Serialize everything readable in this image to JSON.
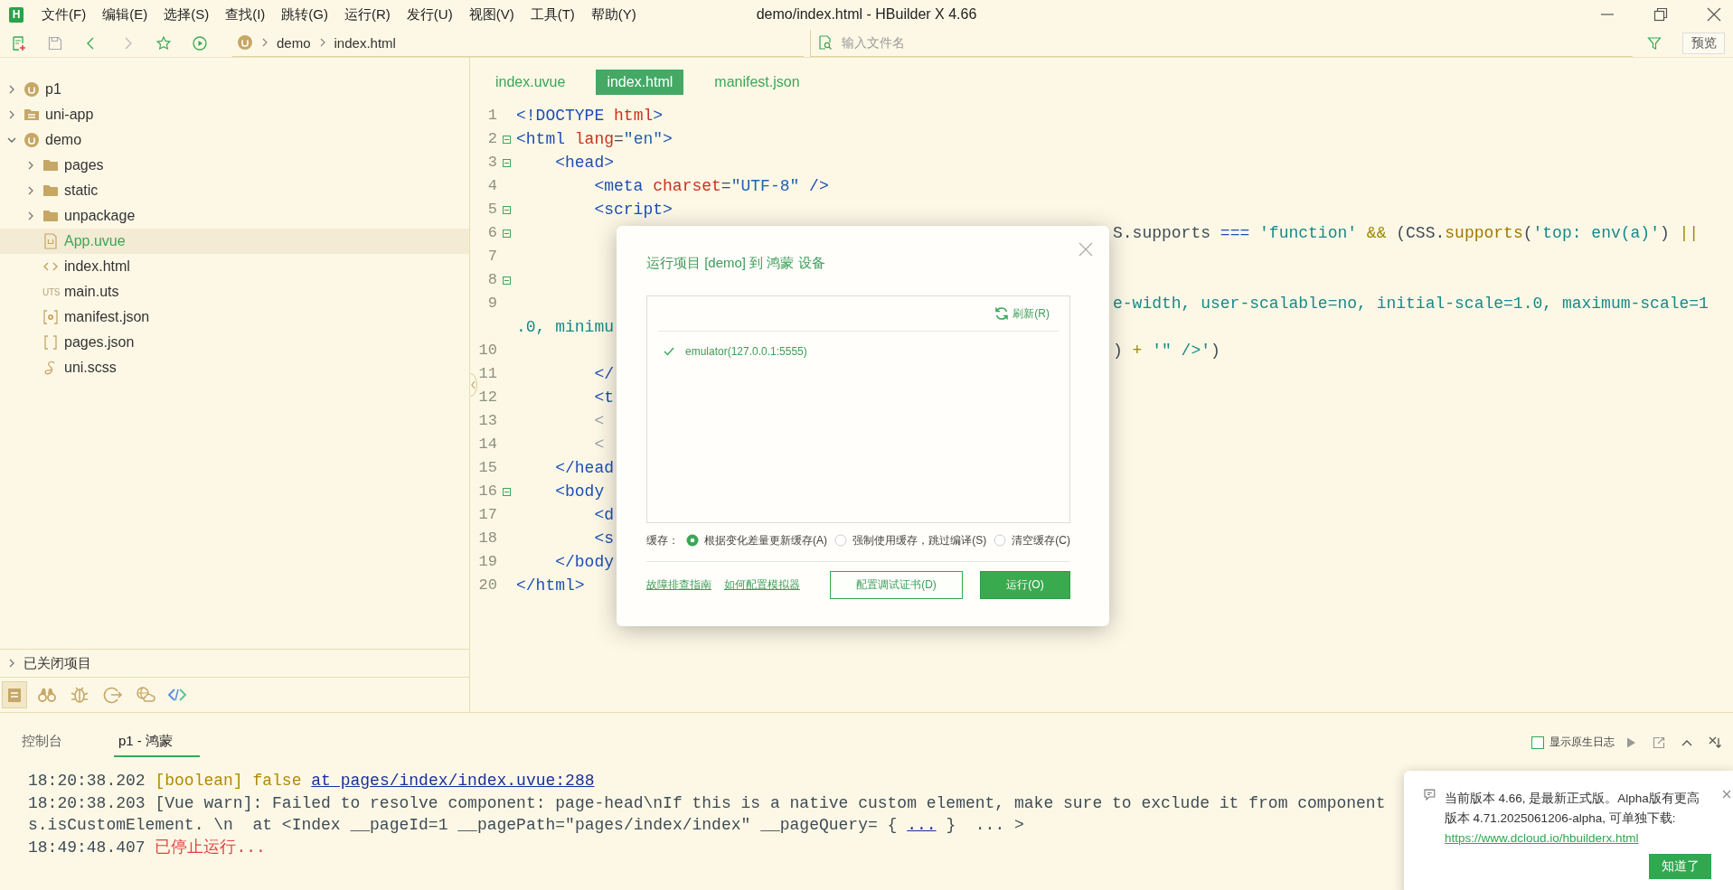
{
  "window": {
    "logo": "H",
    "title": "demo/index.html - HBuilder X 4.66"
  },
  "menu": [
    "文件(F)",
    "编辑(E)",
    "选择(S)",
    "查找(I)",
    "跳转(G)",
    "运行(R)",
    "发行(U)",
    "视图(V)",
    "工具(T)",
    "帮助(Y)"
  ],
  "toolbar": {
    "breadcrumb": [
      "demo",
      "index.html"
    ],
    "search": {
      "placeholder": "输入文件名"
    },
    "preview_button": "预览"
  },
  "sidebar": {
    "tree": [
      {
        "label": "p1",
        "kind": "project",
        "expanded": false,
        "selected": false
      },
      {
        "label": "uni-app",
        "kind": "folderproject",
        "expanded": false,
        "selected": false
      },
      {
        "label": "demo",
        "kind": "project",
        "expanded": true,
        "selected": false,
        "children": [
          {
            "label": "pages",
            "kind": "folder",
            "expanded": false,
            "selected": false
          },
          {
            "label": "static",
            "kind": "folder",
            "expanded": false,
            "selected": false
          },
          {
            "label": "unpackage",
            "kind": "folder",
            "expanded": false,
            "selected": false
          },
          {
            "label": "App.uvue",
            "kind": "uvue",
            "selected": true
          },
          {
            "label": "index.html",
            "kind": "html",
            "selected": false
          },
          {
            "label": "main.uts",
            "kind": "uts",
            "badge": "UTS",
            "selected": false
          },
          {
            "label": "manifest.json",
            "kind": "manifest",
            "selected": false
          },
          {
            "label": "pages.json",
            "kind": "json",
            "selected": false
          },
          {
            "label": "uni.scss",
            "kind": "scss",
            "selected": false
          }
        ]
      }
    ],
    "closed_projects": {
      "label": "已关闭项目",
      "expanded": false
    },
    "tool_tabs": [
      {
        "kind": "project",
        "selected": true
      },
      {
        "kind": "binoculars",
        "selected": false
      },
      {
        "kind": "bug",
        "selected": false
      },
      {
        "kind": "export",
        "selected": false
      },
      {
        "kind": "globe",
        "selected": false
      },
      {
        "kind": "code",
        "selected": false
      }
    ]
  },
  "editor": {
    "tabs": [
      {
        "label": "index.uvue",
        "selected": false
      },
      {
        "label": "index.html",
        "selected": true
      },
      {
        "label": "manifest.json",
        "selected": false
      }
    ],
    "lines": [
      {
        "number": "1",
        "fold": false,
        "left": [
          {
            "kind": "tag",
            "s": "<!DOCTYPE "
          },
          {
            "kind": "attr",
            "s": "html"
          },
          {
            "kind": "tag",
            "s": ">"
          }
        ]
      },
      {
        "number": "2",
        "fold": true,
        "left": [
          {
            "kind": "tag",
            "s": "<html "
          },
          {
            "kind": "attr",
            "s": "lang"
          },
          {
            "kind": "plain",
            "s": "="
          },
          {
            "kind": "val",
            "s": "\"en\""
          },
          {
            "kind": "tag",
            "s": ">"
          }
        ]
      },
      {
        "number": "3",
        "fold": true,
        "left": [
          {
            "kind": "tag",
            "s": "    <head>"
          }
        ]
      },
      {
        "number": "4",
        "fold": false,
        "left": [
          {
            "kind": "tag",
            "s": "        <meta "
          },
          {
            "kind": "attr",
            "s": "charset"
          },
          {
            "kind": "plain",
            "s": "="
          },
          {
            "kind": "val",
            "s": "\"UTF-8\""
          },
          {
            "kind": "tag",
            "s": " />"
          }
        ]
      },
      {
        "number": "5",
        "fold": true,
        "left": [
          {
            "kind": "tag",
            "s": "        <script>"
          }
        ]
      },
      {
        "number": "6",
        "fold": true,
        "right": [
          {
            "kind": "plain",
            "s": "S.supports "
          },
          {
            "kind": "kw",
            "s": "==="
          },
          {
            "kind": "str",
            "s": " 'function' "
          },
          {
            "kind": "op",
            "s": "&&"
          },
          {
            "kind": "plain",
            "s": " (CSS."
          },
          {
            "kind": "fn",
            "s": "supports"
          },
          {
            "kind": "plain",
            "s": "("
          },
          {
            "kind": "str",
            "s": "'top: env(a)'"
          },
          {
            "kind": "plain",
            "s": ") "
          },
          {
            "kind": "op",
            "s": "||"
          }
        ]
      },
      {
        "number": "7",
        "fold": false
      },
      {
        "number": "8",
        "fold": true
      },
      {
        "number": "9",
        "fold": false,
        "right": [
          {
            "kind": "str",
            "s": "e-width, user-scalable=no, initial-scale=1.0, maximum-scale=1"
          }
        ],
        "wrap": [
          {
            "kind": "str",
            "s": ".0, minimu"
          }
        ]
      },
      {
        "number": "10",
        "fold": false,
        "right": [
          {
            "kind": "plain",
            "s": ")"
          },
          {
            "kind": "op",
            "s": " + "
          },
          {
            "kind": "str",
            "s": "'\" />'"
          },
          {
            "kind": "plain",
            "s": ")"
          }
        ]
      },
      {
        "number": "11",
        "fold": false,
        "left": [
          {
            "kind": "tag",
            "s": "        </"
          }
        ]
      },
      {
        "number": "12",
        "fold": false,
        "left": [
          {
            "kind": "tag",
            "s": "        <t"
          }
        ]
      },
      {
        "number": "13",
        "fold": false,
        "left": [
          {
            "kind": "dim",
            "s": "        <"
          }
        ]
      },
      {
        "number": "14",
        "fold": false,
        "left": [
          {
            "kind": "dim",
            "s": "        <"
          }
        ]
      },
      {
        "number": "15",
        "fold": false,
        "left": [
          {
            "kind": "tag",
            "s": "    </head"
          }
        ]
      },
      {
        "number": "16",
        "fold": true,
        "left": [
          {
            "kind": "tag",
            "s": "    <body"
          }
        ]
      },
      {
        "number": "17",
        "fold": false,
        "left": [
          {
            "kind": "tag",
            "s": "        <d"
          }
        ]
      },
      {
        "number": "18",
        "fold": false,
        "left": [
          {
            "kind": "tag",
            "s": "        <s"
          }
        ]
      },
      {
        "number": "19",
        "fold": false,
        "left": [
          {
            "kind": "tag",
            "s": "    </body"
          }
        ]
      },
      {
        "number": "20",
        "fold": false,
        "left": [
          {
            "kind": "tag",
            "s": "</html>"
          }
        ]
      }
    ]
  },
  "dialog": {
    "title": "运行项目 [demo] 到 鸿蒙 设备",
    "refresh": "刷新(R)",
    "devices": [
      {
        "name": "emulator(127.0.0.1:5555)",
        "checked": true
      }
    ],
    "cache": {
      "label": "缓存：",
      "options": [
        {
          "label": "根据变化差量更新缓存(A)",
          "selected": true
        },
        {
          "label": "强制使用缓存，跳过编译(S)",
          "selected": false
        },
        {
          "label": "清空缓存(C)",
          "selected": false
        }
      ]
    },
    "links": [
      "故障排查指南",
      "如何配置模拟器"
    ],
    "buttons": [
      {
        "label": "配置调试证书(D)",
        "kind": "secondary"
      },
      {
        "label": "运行(O)",
        "kind": "primary"
      }
    ]
  },
  "console": {
    "tabs": [
      {
        "label": "控制台",
        "selected": false
      },
      {
        "label": "p1 - 鸿蒙",
        "selected": true
      }
    ],
    "native_log": {
      "label": "显示原生日志",
      "checked": false
    },
    "lines": [
      {
        "segments": [
          {
            "kind": "plain",
            "s": "18:20:38.202 "
          },
          {
            "kind": "warn",
            "s": "[boolean] false "
          },
          {
            "kind": "link",
            "s": "at pages/index/index.uvue:288"
          }
        ]
      },
      {
        "segments": [
          {
            "kind": "plain",
            "s": "18:20:38.203 [Vue warn]: Failed to resolve component: page-head\\nIf this is a native custom element, make sure to exclude it from component"
          }
        ]
      },
      {
        "segments": [
          {
            "kind": "plain",
            "s": "s.isCustomElement. \\n  at <Index __pageId=1 __pagePath=\"pages/index/index\" __pageQuery= { "
          },
          {
            "kind": "link",
            "s": "..."
          },
          {
            "kind": "plain",
            "s": " }  ... >"
          }
        ]
      },
      {
        "segments": [
          {
            "kind": "plain",
            "s": "18:49:48.407 "
          },
          {
            "kind": "error",
            "s": "已停止运行..."
          }
        ]
      }
    ]
  },
  "notification": {
    "message": "当前版本 4.66, 是最新正式版。Alpha版有更高版本 4.71.2025061206-alpha, 可单独下载:",
    "link": "https://www.dcloud.io/hbuilderx.html",
    "button": "知道了"
  }
}
